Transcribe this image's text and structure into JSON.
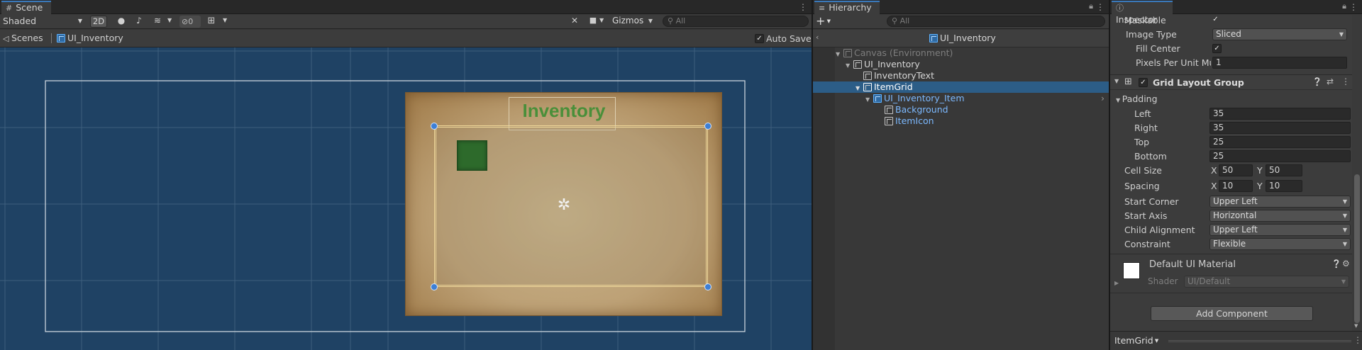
{
  "colors": {
    "accent": "#3a79bb",
    "selection": "#2c5d87",
    "scene_bg": "#1d3d5f",
    "text_blue": "#7cb9ff",
    "inventory_title": "#4a8f3a"
  },
  "scene": {
    "tab_label": "Scene",
    "shading_mode": "Shaded",
    "mode_2d": "2D",
    "hidden_count": "0",
    "gizmos_label": "Gizmos",
    "search_placeholder": "All",
    "breadcrumb_root": "Scenes",
    "breadcrumb_prefab": "UI_Inventory",
    "auto_save_label": "Auto Save",
    "auto_save_checked": "✓",
    "inventory_title": "Inventory"
  },
  "hierarchy": {
    "tab_label": "Hierarchy",
    "search_placeholder": "All",
    "prefab_header": "UI_Inventory",
    "rows": [
      {
        "label": "Canvas (Environment)"
      },
      {
        "label": "UI_Inventory"
      },
      {
        "label": "InventoryText"
      },
      {
        "label": "ItemGrid"
      },
      {
        "label": "UI_Inventory_Item"
      },
      {
        "label": "Background"
      },
      {
        "label": "ItemIcon"
      }
    ]
  },
  "inspector": {
    "tab_label": "Inspector",
    "maskable_label": "Maskable",
    "maskable_checked": "✓",
    "image_type_label": "Image Type",
    "image_type_value": "Sliced",
    "fill_center_label": "Fill Center",
    "fill_center_checked": "✓",
    "pixels_per_unit_label": "Pixels Per Unit Mul",
    "pixels_per_unit_value": "1",
    "component_title": "Grid Layout Group",
    "component_enabled": "✓",
    "padding_label": "Padding",
    "left_label": "Left",
    "left_value": "35",
    "right_label": "Right",
    "right_value": "35",
    "top_label": "Top",
    "top_value": "25",
    "bottom_label": "Bottom",
    "bottom_value": "25",
    "cell_size_label": "Cell Size",
    "cell_x_label": "X",
    "cell_x": "50",
    "cell_y_label": "Y",
    "cell_y": "50",
    "spacing_label": "Spacing",
    "spacing_x_label": "X",
    "spacing_x": "10",
    "spacing_y_label": "Y",
    "spacing_y": "10",
    "start_corner_label": "Start Corner",
    "start_corner_value": "Upper Left",
    "start_axis_label": "Start Axis",
    "start_axis_value": "Horizontal",
    "child_alignment_label": "Child Alignment",
    "child_alignment_value": "Upper Left",
    "constraint_label": "Constraint",
    "constraint_value": "Flexible",
    "material_name": "Default UI Material",
    "shader_label": "Shader",
    "shader_value": "UI/Default",
    "add_component_label": "Add Component",
    "footer_label": "ItemGrid"
  }
}
